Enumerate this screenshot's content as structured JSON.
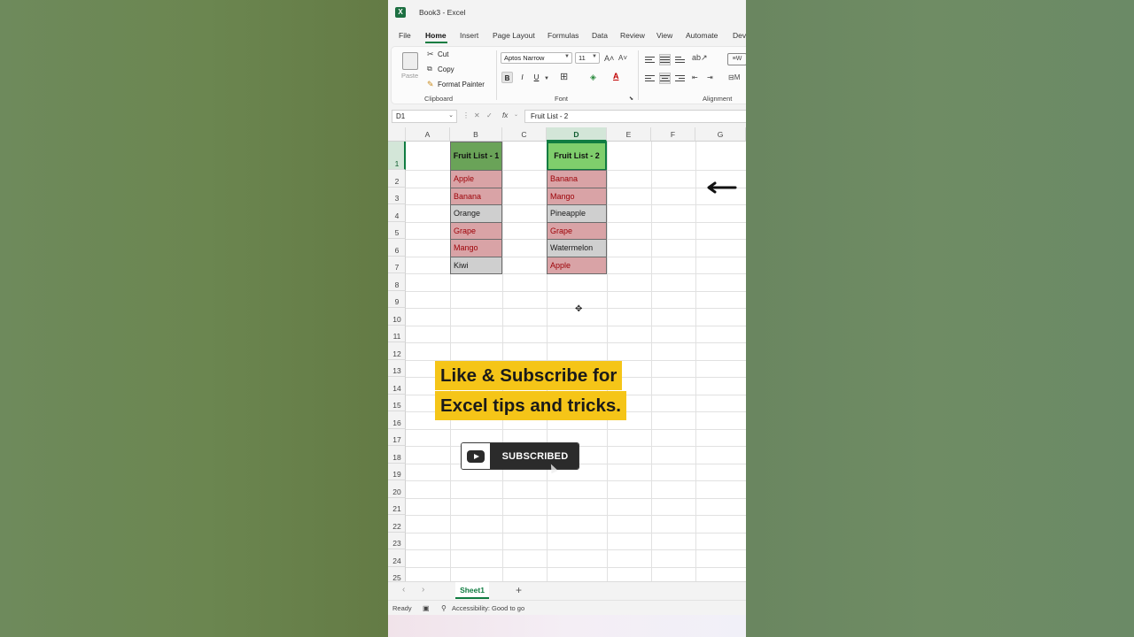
{
  "window": {
    "title": "Book3 - Excel"
  },
  "ribbon": {
    "tabs": [
      "File",
      "Home",
      "Insert",
      "Page Layout",
      "Formulas",
      "Data",
      "Review",
      "View",
      "Automate",
      "Dev"
    ],
    "active_tab": "Home",
    "clipboard": {
      "paste": "Paste",
      "cut": "Cut",
      "copy": "Copy",
      "format_painter": "Format Painter",
      "label": "Clipboard"
    },
    "font": {
      "name": "Aptos Narrow",
      "size": "11",
      "label": "Font"
    },
    "alignment": {
      "label": "Alignment"
    }
  },
  "formula_bar": {
    "name_box": "D1",
    "fx": "fx",
    "value": "Fruit List - 2"
  },
  "grid": {
    "columns": [
      "A",
      "B",
      "C",
      "D",
      "E",
      "F",
      "G"
    ],
    "rows": [
      "1",
      "2",
      "3",
      "4",
      "5",
      "6",
      "7",
      "8",
      "9",
      "10",
      "11",
      "12",
      "13",
      "14",
      "15",
      "16",
      "17",
      "18",
      "19",
      "20",
      "21",
      "22",
      "23",
      "24",
      "25"
    ],
    "list1": {
      "header": "Fruit List - 1",
      "items": [
        "Apple",
        "Banana",
        "Orange",
        "Grape",
        "Mango",
        "Kiwi"
      ],
      "duplicate_flags": [
        true,
        true,
        false,
        true,
        true,
        false
      ]
    },
    "list2": {
      "header": "Fruit List - 2",
      "items": [
        "Banana",
        "Mango",
        "Pineapple",
        "Grape",
        "Watermelon",
        "Apple"
      ],
      "duplicate_flags": [
        true,
        true,
        false,
        true,
        false,
        true
      ]
    }
  },
  "overlay": {
    "promo_line1": "Like & Subscribe for",
    "promo_line2": "Excel tips and tricks.",
    "subscribe_label": "SUBSCRIBED"
  },
  "sheets": {
    "tabs": [
      "Sheet1"
    ],
    "active": "Sheet1"
  },
  "status": {
    "ready": "Ready",
    "accessibility": "Accessibility: Good to go"
  },
  "colors": {
    "excel_green": "#107c41",
    "header_b_fill": "#6aa358",
    "header_d_fill": "#7fce6c",
    "duplicate_fill": "#d9a3a6",
    "duplicate_text": "#9c0006",
    "unique_fill": "#cfcfcf",
    "promo_yellow": "#f5c518"
  }
}
